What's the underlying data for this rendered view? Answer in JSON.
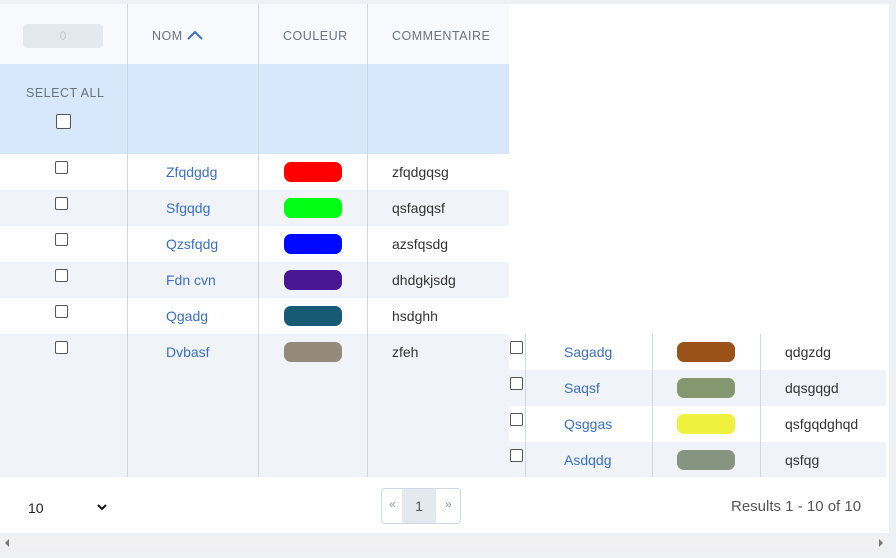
{
  "header": {
    "selected_count": "0",
    "columns": {
      "name": "NOM",
      "color": "COULEUR",
      "comment": "COMMENTAIRE"
    },
    "select_all_label": "SELECT ALL",
    "sort_icon": "chevron-up-icon"
  },
  "rows": [
    {
      "name": "Zfqdgdg",
      "color": "#ff0000",
      "comment": "zfqdgqsg"
    },
    {
      "name": "Sfgqdg",
      "color": "#00ff14",
      "comment": "qsfagqsf"
    },
    {
      "name": "Qzsfqdg",
      "color": "#0008ff",
      "comment": "azsfqsdg"
    },
    {
      "name": "Fdn cvn",
      "color": "#4a1794",
      "comment": "dhdgkjsdg"
    },
    {
      "name": "Qgadg",
      "color": "#185a74",
      "comment": "hsdghh"
    },
    {
      "name": "Dvbasf",
      "color": "#948a7c",
      "comment": "zfeh"
    },
    {
      "name": "Sagadg",
      "color": "#9a5219",
      "comment": "qdgzdg"
    },
    {
      "name": "Saqsf",
      "color": "#85976e",
      "comment": "dqsgqgd"
    },
    {
      "name": "Qsggas",
      "color": "#eef23c",
      "comment": "qsfgqdghqd"
    },
    {
      "name": "Asdqdg",
      "color": "#87947f",
      "comment": "qsfqg"
    }
  ],
  "footer": {
    "page_size": "10",
    "pagination": {
      "prev": "«",
      "current": "1",
      "next": "»"
    },
    "results_text": "Results 1 - 10 of 10"
  },
  "colors": {
    "accent": "#3a6fc7",
    "header_bg": "#f7f9fc",
    "select_all_bg": "#d7e8fd",
    "alt_row_bg": "#f0f3f8"
  }
}
